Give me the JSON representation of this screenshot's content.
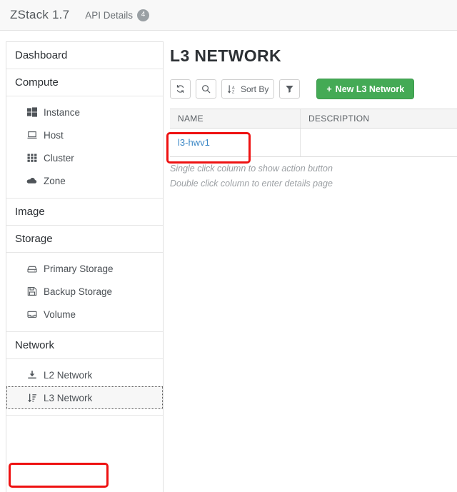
{
  "topbar": {
    "brand": "ZStack 1.7",
    "api_details_label": "API Details",
    "api_details_count": "4"
  },
  "sidebar": {
    "sections": [
      {
        "title": "Dashboard",
        "items": []
      },
      {
        "title": "Compute",
        "items": [
          {
            "label": "Instance",
            "icon": "windows-grid-icon"
          },
          {
            "label": "Host",
            "icon": "desktop-icon"
          },
          {
            "label": "Cluster",
            "icon": "grid-dots-icon"
          },
          {
            "label": "Zone",
            "icon": "cloud-icon"
          }
        ]
      },
      {
        "title": "Image",
        "items": []
      },
      {
        "title": "Storage",
        "items": [
          {
            "label": "Primary Storage",
            "icon": "hdd-icon"
          },
          {
            "label": "Backup Storage",
            "icon": "floppy-save-icon"
          },
          {
            "label": "Volume",
            "icon": "inbox-tray-icon"
          }
        ]
      },
      {
        "title": "Network",
        "items": [
          {
            "label": "L2 Network",
            "icon": "download-arrow-icon"
          },
          {
            "label": "L3 Network",
            "icon": "sort-amount-down-icon"
          }
        ]
      }
    ]
  },
  "main": {
    "page_title": "L3 NETWORK",
    "toolbar": {
      "refresh_label": "",
      "search_label": "",
      "sort_label": "Sort By",
      "filter_label": "",
      "new_button_label": "New L3 Network",
      "new_button_plus": "+"
    },
    "table": {
      "columns": [
        "NAME",
        "DESCRIPTION"
      ],
      "rows": [
        {
          "name": "l3-hwv1",
          "description": ""
        }
      ]
    },
    "hints": [
      "Single click column to show action button",
      "Double click column to enter details page"
    ]
  },
  "colors": {
    "accent_green": "#44aa55",
    "link_blue": "#3b87c6",
    "annotation_red": "#ee1111",
    "topbar_bg": "#f8f8f8",
    "table_header_bg": "#f4f4f4"
  }
}
